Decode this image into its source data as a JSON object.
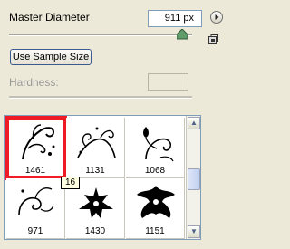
{
  "master_diameter": {
    "label": "Master Diameter",
    "value": "911 px"
  },
  "use_sample_size": {
    "label": "Use Sample Size"
  },
  "hardness": {
    "label": "Hardness:",
    "value": ""
  },
  "brushes": [
    {
      "number": "1461",
      "selected": true
    },
    {
      "number": "1131",
      "selected": false
    },
    {
      "number": "1068",
      "selected": false
    },
    {
      "number": "971",
      "selected": false
    },
    {
      "number": "1430",
      "selected": false
    },
    {
      "number": "1151",
      "selected": false
    }
  ],
  "tooltip": "16",
  "colors": {
    "selection": "#ee1b24",
    "slider_thumb": "#5f9c6a"
  }
}
